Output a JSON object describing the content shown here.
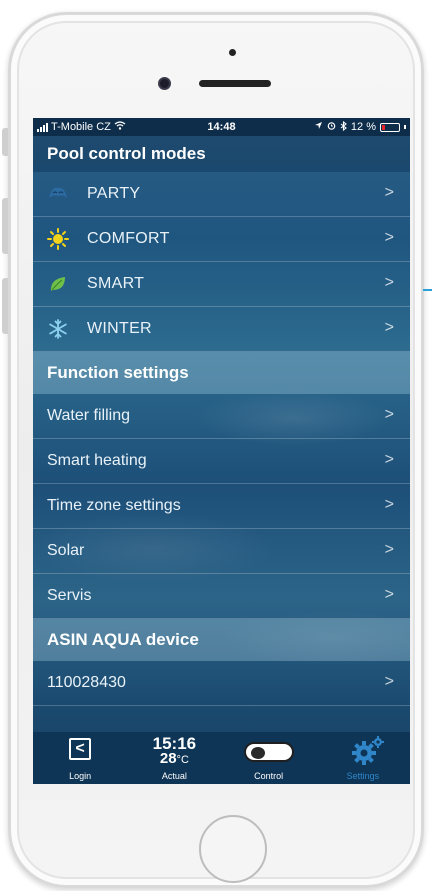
{
  "status_bar": {
    "carrier": "T-Mobile CZ",
    "time": "14:48",
    "battery_percent": "12 %"
  },
  "sections": {
    "pool_modes": {
      "title": "Pool control modes",
      "items": [
        {
          "label": "PARTY",
          "icon": "party-mask-icon"
        },
        {
          "label": "COMFORT",
          "icon": "sun-icon"
        },
        {
          "label": "SMART",
          "icon": "leaf-icon"
        },
        {
          "label": "WINTER",
          "icon": "snowflake-icon"
        }
      ]
    },
    "function_settings": {
      "title": "Function settings",
      "items": [
        {
          "label": "Water filling"
        },
        {
          "label": "Smart heating"
        },
        {
          "label": "Time zone settings"
        },
        {
          "label": "Solar"
        },
        {
          "label": "Servis"
        }
      ]
    },
    "device": {
      "title": "ASIN AQUA device",
      "items": [
        {
          "label": "110028430"
        }
      ]
    }
  },
  "tab_bar": {
    "login_label": "Login",
    "actual_time": "15:16",
    "actual_temp": "28",
    "actual_temp_unit": "°C",
    "actual_label": "Actual",
    "control_label": "Control",
    "settings_label": "Settings",
    "active_tab": "Settings"
  },
  "colors": {
    "accent": "#2f86c9",
    "status_bar_bg": "#0d2d4a",
    "tab_bar_bg": "#0f3556",
    "battery_low": "#e8262a",
    "sun": "#f2d21a",
    "leaf": "#6fc04a",
    "snowflake": "#8cd3f0",
    "party": "#2e6ea8"
  }
}
